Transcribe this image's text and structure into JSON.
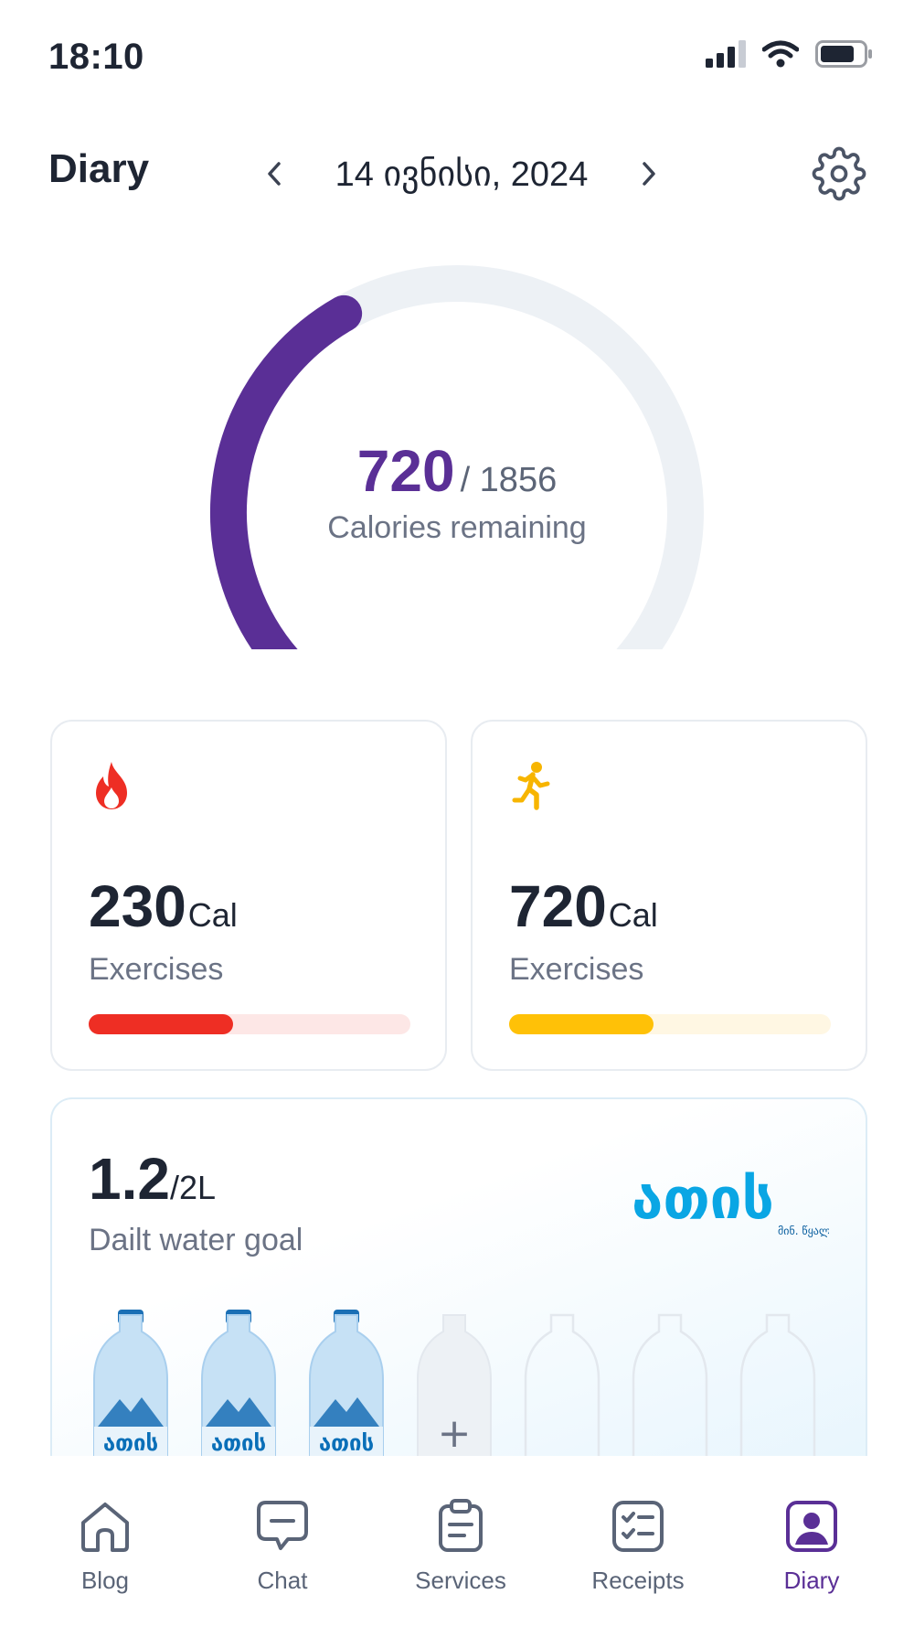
{
  "status_bar": {
    "time": "18:10"
  },
  "header": {
    "title": "Diary",
    "date": "14 ივნისი, 2024"
  },
  "calories": {
    "remaining": "720",
    "total": "/ 1856",
    "label": "Calories remaining",
    "progress_fraction": 0.39,
    "color": "#5a2f96"
  },
  "cards": [
    {
      "icon": "fire-icon",
      "value": "230",
      "unit": "Cal",
      "label": "Exercises",
      "progress": 0.45,
      "color": "#ee2e24",
      "track_color": "#fde7e6"
    },
    {
      "icon": "running-person-icon",
      "value": "720",
      "unit": "Cal",
      "label": "Exercises",
      "progress": 0.45,
      "color": "#ffc107",
      "track_color": "#fff7e3"
    }
  ],
  "water": {
    "value": "1.2",
    "unit": "/2L",
    "label": "Dailt water goal",
    "brand": "ათის",
    "brand_sub": "მინ. წყალი",
    "bottle_label": "ათის",
    "filled_bottles": 3,
    "total_bottles": 7,
    "add_symbol": "+"
  },
  "bottom_nav": [
    {
      "label": "Blog",
      "icon": "home-icon",
      "active": false
    },
    {
      "label": "Chat",
      "icon": "chat-icon",
      "active": false
    },
    {
      "label": "Services",
      "icon": "clipboard-icon",
      "active": false
    },
    {
      "label": "Receipts",
      "icon": "checklist-icon",
      "active": false
    },
    {
      "label": "Diary",
      "icon": "profile-icon",
      "active": true
    }
  ]
}
